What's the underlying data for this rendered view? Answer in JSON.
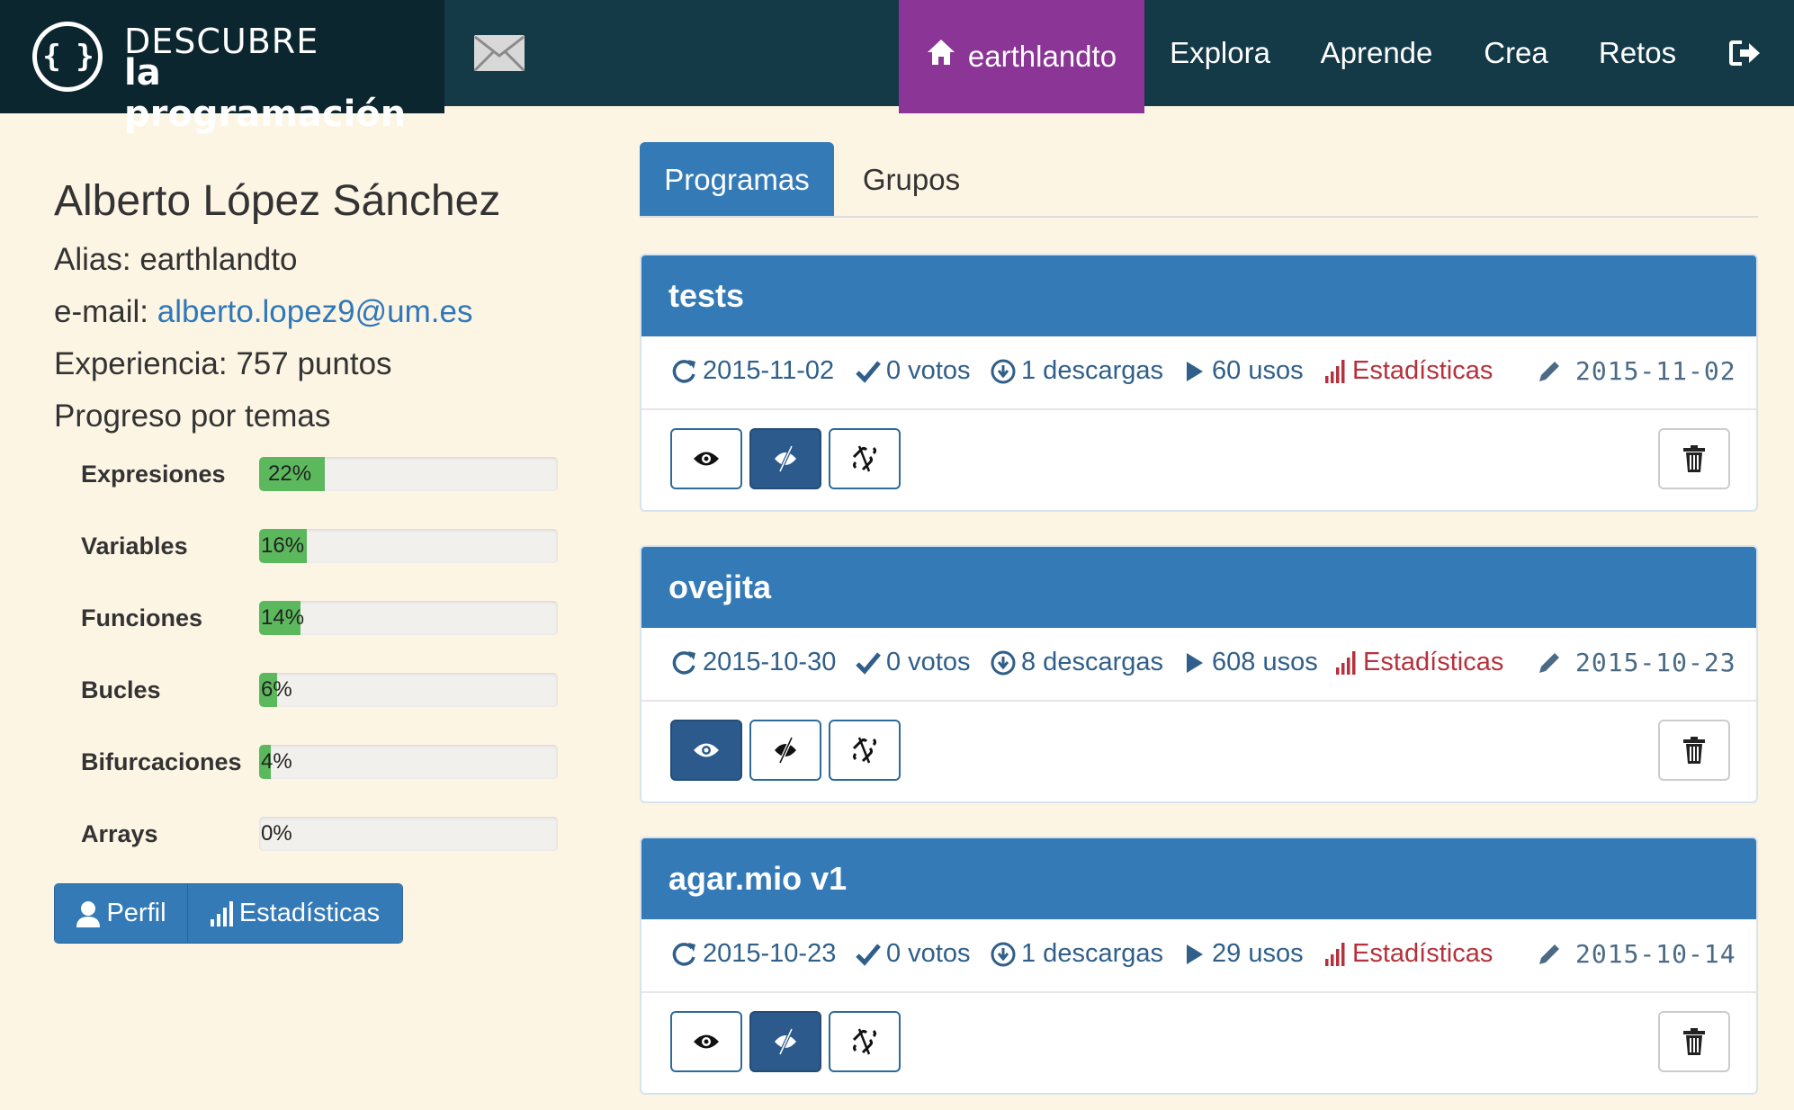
{
  "brand": {
    "line1": "DESCUBRE",
    "line2": "la programación",
    "logo_symbol": "{ }"
  },
  "nav": {
    "user": "earthlandto",
    "items": [
      "Explora",
      "Aprende",
      "Crea",
      "Retos"
    ]
  },
  "profile": {
    "name": "Alberto López Sánchez",
    "alias_label": "Alias:",
    "alias": "earthlandto",
    "email_label": "e-mail:",
    "email": "alberto.lopez9@um.es",
    "experience": "Experiencia: 757 puntos",
    "progress_title": "Progreso por temas",
    "topics": [
      {
        "label": "Expresiones",
        "value": "22%",
        "fraction": 0.22
      },
      {
        "label": "Variables",
        "value": "16%",
        "fraction": 0.16
      },
      {
        "label": "Funciones",
        "value": "14%",
        "fraction": 0.14
      },
      {
        "label": "Bucles",
        "value": "6%",
        "fraction": 0.06
      },
      {
        "label": "Bifurcaciones",
        "value": "4%",
        "fraction": 0.04
      },
      {
        "label": "Arrays",
        "value": "0%",
        "fraction": 0.0
      }
    ],
    "buttons": {
      "perfil": "Perfil",
      "stats": "Estadísticas"
    }
  },
  "tabs": [
    "Programas",
    "Grupos"
  ],
  "programs": [
    {
      "title": "tests",
      "updated": "2015-11-02",
      "votes": "0 votos",
      "downloads": "1 descargas",
      "uses": "60 usos",
      "stats": "Estadísticas",
      "edited": "2015-11-02",
      "active_toggle": "hidden"
    },
    {
      "title": "ovejita",
      "updated": "2015-10-30",
      "votes": "0 votos",
      "downloads": "8 descargas",
      "uses": "608 usos",
      "stats": "Estadísticas",
      "edited": "2015-10-23",
      "active_toggle": "visible"
    },
    {
      "title": "agar.mio v1",
      "updated": "2015-10-23",
      "votes": "0 votos",
      "downloads": "1 descargas",
      "uses": "29 usos",
      "stats": "Estadísticas",
      "edited": "2015-10-14",
      "active_toggle": "hidden"
    }
  ],
  "colors": {
    "nav_bg": "#143a48",
    "brand_bg": "#0c2630",
    "active_nav": "#8b3596",
    "primary": "#337ab7",
    "progress": "#5cb85c",
    "stats_red": "#b5323c",
    "page_bg": "#fdf5e4"
  }
}
